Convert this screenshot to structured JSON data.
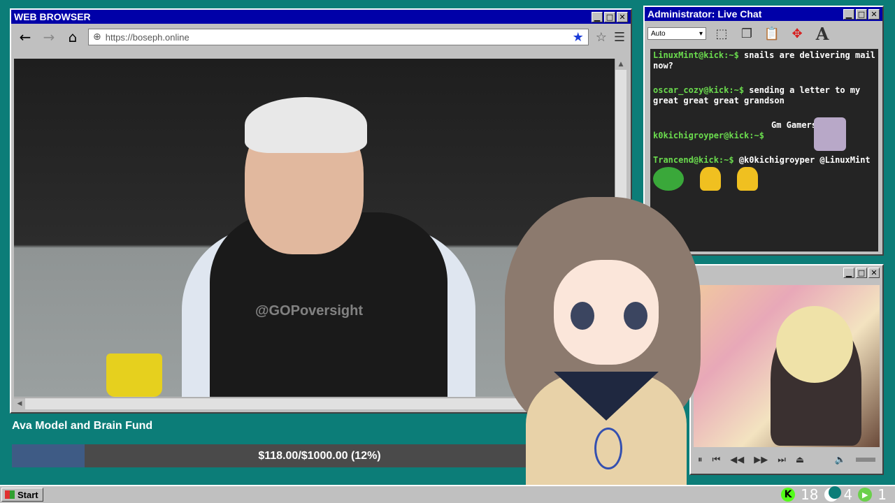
{
  "browser": {
    "title": "WEB BROWSER",
    "url": "https://boseph.online",
    "watermark": "@GOPoversight",
    "controls": {
      "minimize": "▁",
      "maximize": "□",
      "close": "✕"
    }
  },
  "chat": {
    "title": "Administrator: Live Chat",
    "select_value": "Auto",
    "messages": [
      {
        "user": "LinuxMint@kick:~$",
        "text": " snails are delivering mail now?"
      },
      {
        "user": "oscar_cozy@kick:~$",
        "text": " sending a letter to my great great great grandson"
      },
      {
        "user": "k0kichigroyper@kick:~$",
        "text": "Gm Gamers"
      },
      {
        "user": "Trancend@kick:~$",
        "text": " @k0kichigroyper @LinuxMint"
      }
    ]
  },
  "fund": {
    "title": "Ava Model and Brain Fund",
    "progress_text": "$118.00/$1000.00 (12%)",
    "progress_fraction": 0.118,
    "fill_color": "#3e5b85"
  },
  "taskbar": {
    "start_label": "Start",
    "tray": {
      "kick_count": "18",
      "moon_count": "4",
      "play_count": "1"
    }
  }
}
